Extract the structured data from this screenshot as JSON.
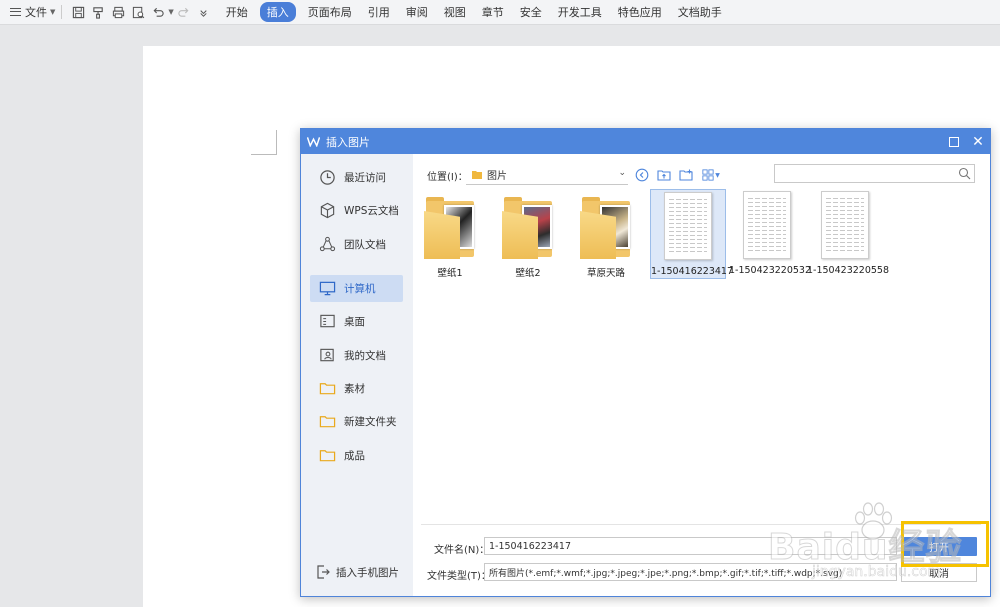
{
  "menubar": {
    "file_label": "文件",
    "tabs": [
      {
        "label": "开始",
        "active": false
      },
      {
        "label": "插入",
        "active": true
      },
      {
        "label": "页面布局",
        "active": false
      },
      {
        "label": "引用",
        "active": false
      },
      {
        "label": "审阅",
        "active": false
      },
      {
        "label": "视图",
        "active": false
      },
      {
        "label": "章节",
        "active": false
      },
      {
        "label": "安全",
        "active": false
      },
      {
        "label": "开发工具",
        "active": false
      },
      {
        "label": "特色应用",
        "active": false
      },
      {
        "label": "文档助手",
        "active": false
      }
    ],
    "accent_color": "#4a7ed8"
  },
  "dialog": {
    "title": "插入图片",
    "sidebar": {
      "items": [
        {
          "label": "最近访问",
          "icon": "clock-icon"
        },
        {
          "label": "WPS云文档",
          "icon": "cube-icon"
        },
        {
          "label": "团队文档",
          "icon": "team-icon"
        },
        {
          "label": "计算机",
          "icon": "computer-icon",
          "selected": true
        },
        {
          "label": "桌面",
          "icon": "desktop-icon"
        },
        {
          "label": "我的文档",
          "icon": "my-documents-icon"
        },
        {
          "label": "素材",
          "icon": "folder-icon"
        },
        {
          "label": "新建文件夹",
          "icon": "folder-icon"
        },
        {
          "label": "成品",
          "icon": "folder-icon"
        }
      ],
      "bottom_label": "插入手机图片"
    },
    "location": {
      "label": "位置(I)：",
      "value": "图片"
    },
    "search": {
      "placeholder": ""
    },
    "files": [
      {
        "name": "壁纸1",
        "type": "folder"
      },
      {
        "name": "壁纸2",
        "type": "folder"
      },
      {
        "name": "草原天路",
        "type": "folder"
      },
      {
        "name": "1-150416223417",
        "type": "image",
        "selected": true
      },
      {
        "name": "1-150423220532",
        "type": "image"
      },
      {
        "name": "1-150423220558",
        "type": "image"
      }
    ],
    "filename_label": "文件名(N)：",
    "filename_value": "1-150416223417",
    "filetype_label": "文件类型(T)：",
    "filetype_value": "所有图片(*.emf;*.wmf;*.jpg;*.jpeg;*.jpe;*.png;*.bmp;*.gif;*.tif;*.tiff;*.wdp;*.svg)",
    "open_label": "打开",
    "cancel_label": "取消"
  },
  "watermark": {
    "main": "Baidu经验",
    "sub": "jingyan.baidu.com"
  }
}
